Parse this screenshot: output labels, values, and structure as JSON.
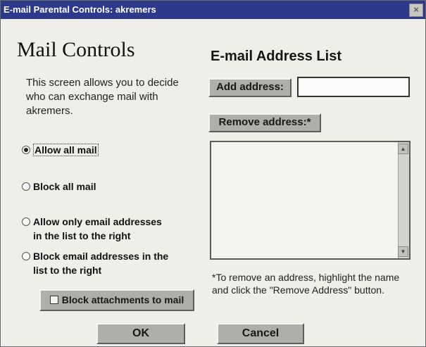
{
  "window": {
    "title": "E-mail Parental Controls: akremers",
    "close_glyph": "×"
  },
  "left": {
    "heading": "Mail Controls",
    "description": "This screen allows you to decide who can exchange mail with akremers.",
    "options": [
      {
        "line1": "Allow all mail",
        "line2": "",
        "selected": true
      },
      {
        "line1": "Block all mail",
        "line2": "",
        "selected": false
      },
      {
        "line1": "Allow only email addresses",
        "line2": "in the list to the right",
        "selected": false
      },
      {
        "line1": "Block email addresses in the",
        "line2": "list to the right",
        "selected": false
      }
    ],
    "attach_label": "Block attachments to mail",
    "attach_checked": false
  },
  "right": {
    "heading": "E-mail Address List",
    "add_label": "Add address:",
    "address_value": "",
    "remove_label": "Remove address:*",
    "addresses": [],
    "note": "*To remove an address, highlight the name and click the \"Remove Address\" button."
  },
  "buttons": {
    "ok_label": "OK",
    "cancel_label": "Cancel"
  },
  "colors": {
    "titlebar": "#2d3a8c",
    "button_face": "#b0aeaa",
    "window_bg": "#efeee9"
  },
  "icons": {
    "close": "close-icon",
    "radio": "radio-button-icon",
    "checkbox": "checkbox-icon",
    "scroll_up": "scroll-up-arrow-icon",
    "scroll_down": "scroll-down-arrow-icon"
  }
}
